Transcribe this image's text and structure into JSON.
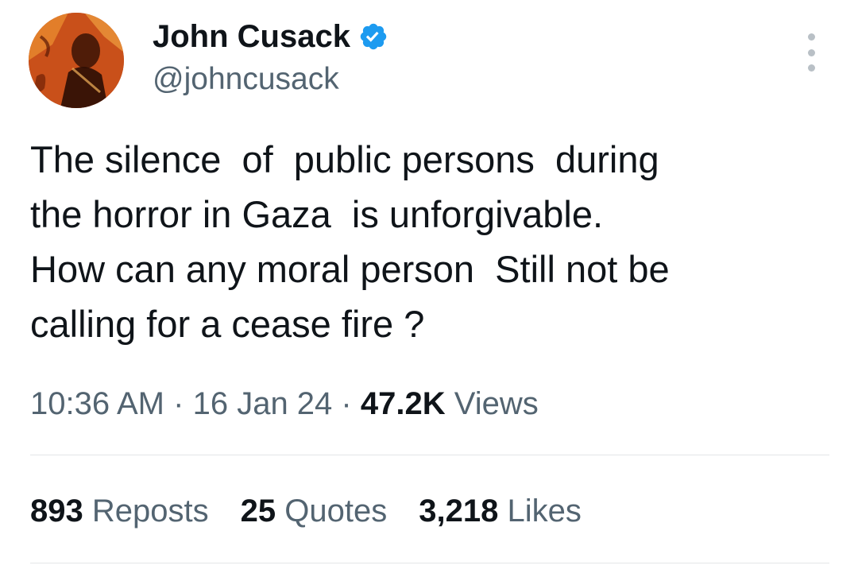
{
  "author": {
    "display_name": "John Cusack",
    "handle": "@johncusack",
    "verified": true
  },
  "icons": {
    "verified": "verified-badge-icon",
    "more": "more-options-icon"
  },
  "colors": {
    "verified_blue": "#1d9bf0",
    "text_primary": "#0f1419",
    "text_secondary": "#536471"
  },
  "tweet": {
    "lines": [
      "The silence  of  public persons  during",
      "the horror in Gaza  is unforgivable.",
      "How can any moral person  Still not be",
      "calling for a cease fire ?"
    ]
  },
  "meta": {
    "time": "10:36 AM",
    "separator": "·",
    "date": "16 Jan 24",
    "views_count": "47.2K",
    "views_label": "Views"
  },
  "stats": {
    "reposts": {
      "count": "893",
      "label": "Reposts"
    },
    "quotes": {
      "count": "25",
      "label": "Quotes"
    },
    "likes": {
      "count": "3,218",
      "label": "Likes"
    }
  }
}
